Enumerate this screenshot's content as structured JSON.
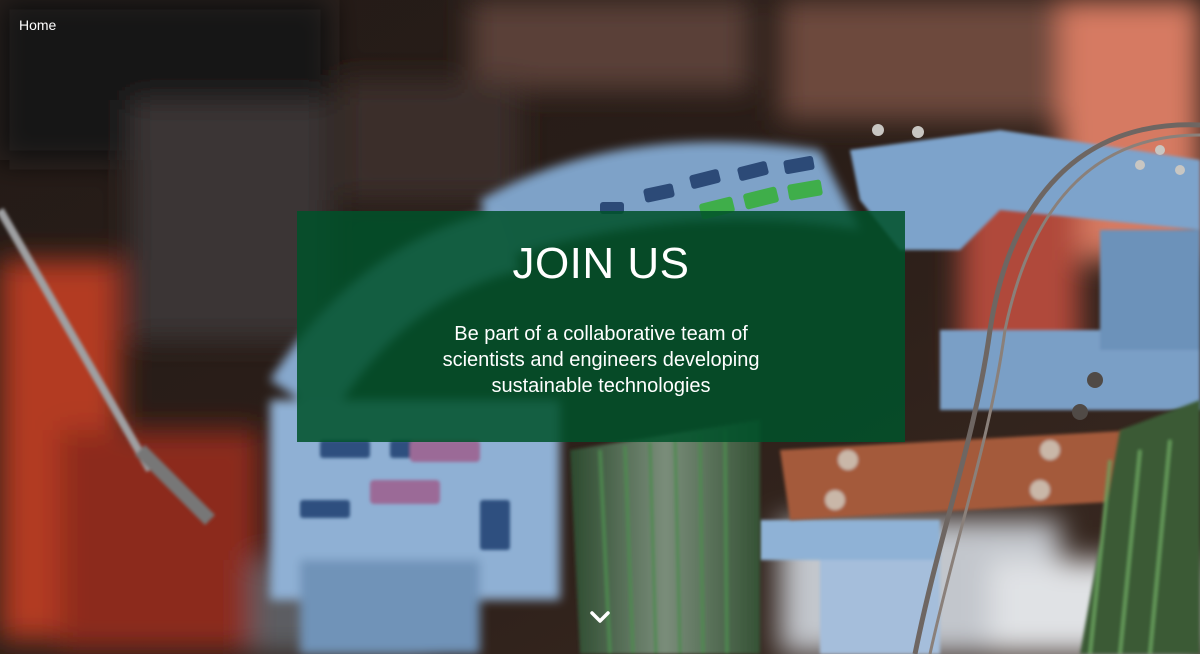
{
  "breadcrumb": {
    "home_label": "Home"
  },
  "hero": {
    "title": "JOIN US",
    "description": "Be part of a collaborative team of scientists and engineers developing sustainable technologies",
    "scroll_icon": "chevron-down-icon"
  },
  "colors": {
    "banner": "#00522a",
    "text": "#ffffff",
    "board_blue": "#7fa6cc",
    "accent_green": "#3fae4a"
  }
}
